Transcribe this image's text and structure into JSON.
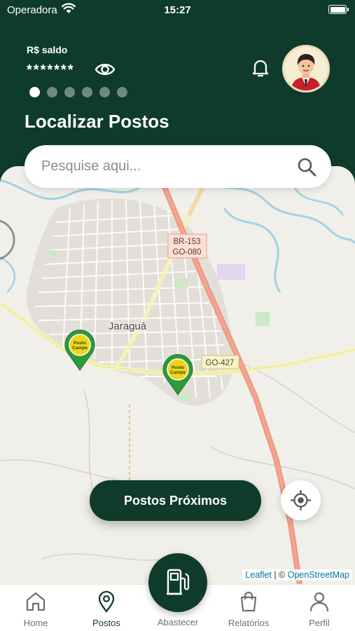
{
  "status_bar": {
    "carrier": "Operadora",
    "time": "15:27"
  },
  "wallet": {
    "balance_label": "R$ saldo",
    "balance_masked": "*******",
    "carousel_pages": 6,
    "active_page": 1
  },
  "page": {
    "title": "Localizar Postos"
  },
  "search": {
    "placeholder": "Pesquise aqui..."
  },
  "map": {
    "city_label": "Jaraguá",
    "road_labels": {
      "br153": "BR-153",
      "go080": "GO-080",
      "go427": "GO-427"
    },
    "marker_label": "Posto Campe",
    "attribution": {
      "leaflet": "Leaflet",
      "separator": " | © ",
      "osm": "OpenStreetMap"
    }
  },
  "nearby_button": {
    "label": "Postos Próximos"
  },
  "tabs": [
    {
      "label": "Home",
      "icon": "home-icon"
    },
    {
      "label": "Postos",
      "icon": "location-pin-icon"
    },
    {
      "label": "Abastecer",
      "icon": "fuel-pump-icon"
    },
    {
      "label": "Relatórios",
      "icon": "shopping-bag-icon"
    },
    {
      "label": "Perfil",
      "icon": "user-icon"
    }
  ],
  "colors": {
    "primary": "#0e3b2c",
    "map_bg": "#f1efe9",
    "highway": "#f2a58f",
    "marker_green": "#2f9a3a",
    "marker_yellow": "#f3d417",
    "water": "#9fd3e6"
  }
}
